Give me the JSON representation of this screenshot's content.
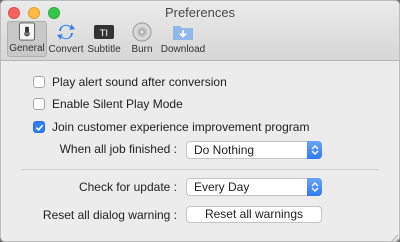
{
  "window": {
    "title": "Preferences"
  },
  "toolbar": {
    "tabs": [
      {
        "label": "General",
        "selected": true
      },
      {
        "label": "Convert",
        "selected": false
      },
      {
        "label": "Subtitle",
        "selected": false
      },
      {
        "label": "Burn",
        "selected": false
      },
      {
        "label": "Download",
        "selected": false
      }
    ]
  },
  "general": {
    "options": [
      {
        "label": "Play alert sound after conversion",
        "checked": false
      },
      {
        "label": "Enable Silent Play Mode",
        "checked": false
      },
      {
        "label": "Join customer experience improvement program",
        "checked": true
      }
    ],
    "finish": {
      "label": "When all job finished :",
      "value": "Do Nothing"
    },
    "update": {
      "label": "Check for update :",
      "value": "Every Day"
    },
    "reset": {
      "label": "Reset all dialog warning :",
      "button": "Reset all warnings"
    }
  },
  "colors": {
    "accent": "#2f7ef4",
    "selected_tab_bg": "#c8c8c8"
  }
}
